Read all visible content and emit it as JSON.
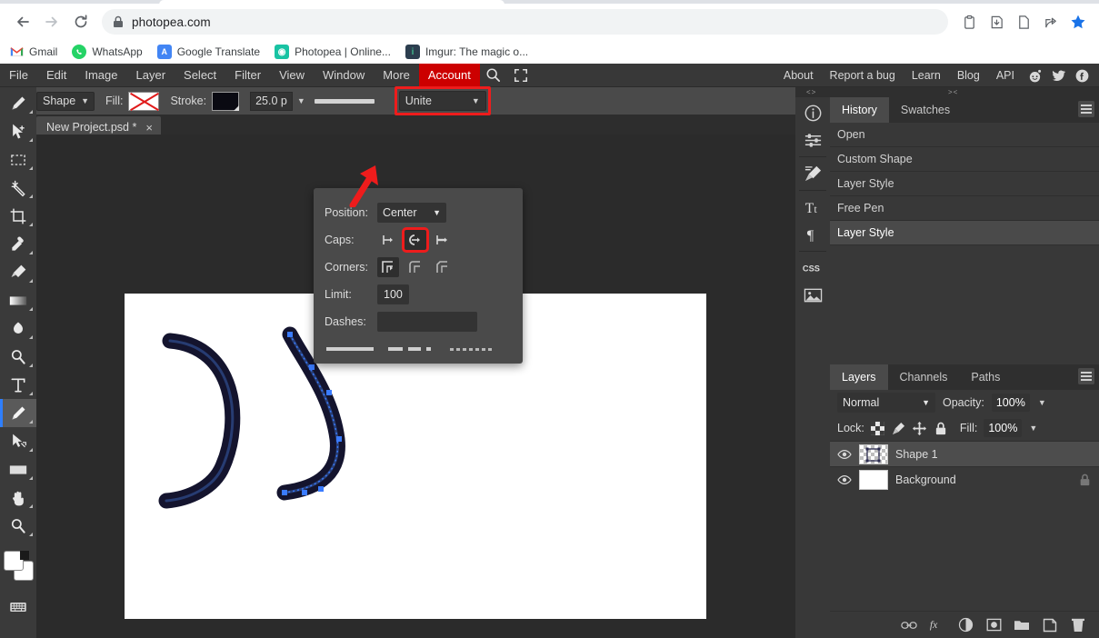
{
  "browser": {
    "url": "photopea.com",
    "nav": {
      "back": "back-arrow",
      "forward": "forward-arrow",
      "reload": "reload-icon",
      "lock": "lock-icon"
    },
    "toolbar_icons": [
      "clipboard-icon",
      "download-icon",
      "page-icon",
      "share-icon",
      "bookmark-star-icon"
    ],
    "bookmarks": [
      {
        "label": "Gmail",
        "icon": "gmail-icon"
      },
      {
        "label": "WhatsApp",
        "icon": "whatsapp-icon"
      },
      {
        "label": "Google Translate",
        "icon": "google-translate-icon"
      },
      {
        "label": "Photopea | Online...",
        "icon": "photopea-icon"
      },
      {
        "label": "Imgur: The magic o...",
        "icon": "imgur-icon"
      }
    ]
  },
  "app": {
    "menu": {
      "items": [
        "File",
        "Edit",
        "Image",
        "Layer",
        "Select",
        "Filter",
        "View",
        "Window",
        "More"
      ],
      "account": "Account",
      "search_icon": "search-icon",
      "fullscreen_icon": "fullscreen-icon",
      "right_links": [
        "About",
        "Report a bug",
        "Learn",
        "Blog",
        "API"
      ],
      "socials": [
        "reddit-icon",
        "twitter-icon",
        "facebook-icon"
      ],
      "account_color": "#cc0000"
    },
    "options": {
      "tool_icon": "pen-tool-icon",
      "mode": "Shape",
      "fill_label": "Fill:",
      "fill_value": "none",
      "stroke_label": "Stroke:",
      "stroke_color": "#0a0a12",
      "stroke_width": "25.0 p",
      "stroke_preview": "solid-line",
      "path_op": "Unite",
      "highlight_color": "#ee1c1c"
    },
    "doc_tab": {
      "title": "New Project.psd *",
      "close": "×"
    },
    "stroke_popup": {
      "position_label": "Position:",
      "position_value": "Center",
      "caps_label": "Caps:",
      "caps_options": [
        "butt-cap-icon",
        "round-cap-icon",
        "square-cap-icon"
      ],
      "caps_selected_index": 1,
      "corners_label": "Corners:",
      "corners_options": [
        "miter-corner-icon",
        "round-corner-icon",
        "bevel-corner-icon"
      ],
      "corners_selected_index": 0,
      "limit_label": "Limit:",
      "limit_value": "100",
      "dashes_label": "Dashes:",
      "dashes_value": "",
      "dash_presets": [
        "solid",
        "dashed",
        "dotted"
      ]
    },
    "toolbar": [
      "pen-tool-icon",
      "move-tool-icon",
      "rectangular-marquee-icon",
      "magic-wand-icon",
      "crop-tool-icon",
      "eyedropper-icon",
      "healing-brush-icon",
      "gradient-tool-icon",
      "paint-bucket-icon",
      "dodge-tool-icon",
      "type-tool-icon",
      "pen-tool-icon-2",
      "path-select-icon",
      "shape-tool-icon",
      "hand-tool-icon",
      "zoom-tool-icon"
    ],
    "toolbar_active_index": 11,
    "toolbar_extra": {
      "color_picker": "foreground-background-colors",
      "keyboard": "keyboard-icon"
    },
    "right_panel": {
      "grip_left": "<>",
      "grip_right": "><",
      "icon_column": [
        "info-icon",
        "adjustments-icon",
        "brush-settings-icon",
        "character-icon",
        "paragraph-icon",
        "css-icon",
        "image-icon"
      ],
      "top_tabs": [
        {
          "label": "History",
          "active": true
        },
        {
          "label": "Swatches",
          "active": false
        }
      ],
      "history": [
        {
          "label": "Open",
          "active": false
        },
        {
          "label": "Custom Shape",
          "active": false
        },
        {
          "label": "Layer Style",
          "active": false
        },
        {
          "label": "Free Pen",
          "active": false
        },
        {
          "label": "Layer Style",
          "active": true
        }
      ],
      "bottom_tabs": [
        {
          "label": "Layers",
          "active": true
        },
        {
          "label": "Channels",
          "active": false
        },
        {
          "label": "Paths",
          "active": false
        }
      ],
      "blend_mode": "Normal",
      "opacity_label": "Opacity:",
      "opacity_value": "100%",
      "lock_label": "Lock:",
      "lock_icons": [
        "lock-transparency-icon",
        "lock-pixels-icon",
        "lock-position-icon",
        "lock-all-icon"
      ],
      "fill_label": "Fill:",
      "fill_value": "100%",
      "layers": [
        {
          "name": "Shape 1",
          "active": true,
          "thumb": "transparent-shape",
          "locked": false
        },
        {
          "name": "Background",
          "active": false,
          "thumb": "white",
          "locked": true
        }
      ],
      "footer_icons": [
        "link-layers-icon",
        "layer-fx-icon",
        "adjustment-layer-icon",
        "layer-mask-icon",
        "new-group-icon",
        "new-layer-icon",
        "delete-layer-icon"
      ]
    },
    "canvas": {
      "background": "#ffffff",
      "shapes": [
        {
          "name": "stroked-arc-left",
          "stroke": "#12122c",
          "selected": false
        },
        {
          "name": "stroked-arc-right",
          "stroke": "#12122c",
          "selected": true,
          "anchor_color": "#3a7bff"
        }
      ]
    },
    "annotation": {
      "arrow": "red-arrow-pointing-to-unite",
      "color": "#ee1c1c"
    }
  }
}
